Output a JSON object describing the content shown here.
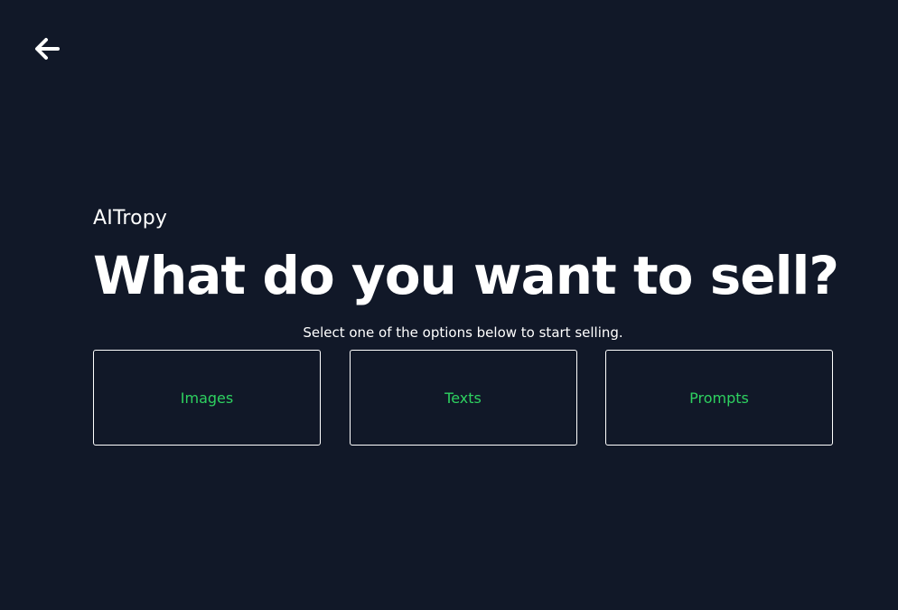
{
  "navigation": {
    "back_icon": "arrow-left-icon"
  },
  "brand": {
    "name": "AITropy"
  },
  "main": {
    "headline": "What do you want to sell?",
    "subtitle": "Select one of the options below to start selling.",
    "options": [
      {
        "label": "Images"
      },
      {
        "label": "Texts"
      },
      {
        "label": "Prompts"
      }
    ]
  },
  "colors": {
    "background": "#111828",
    "text": "#ffffff",
    "accent": "#2ed160",
    "card_border": "#ffffff"
  }
}
